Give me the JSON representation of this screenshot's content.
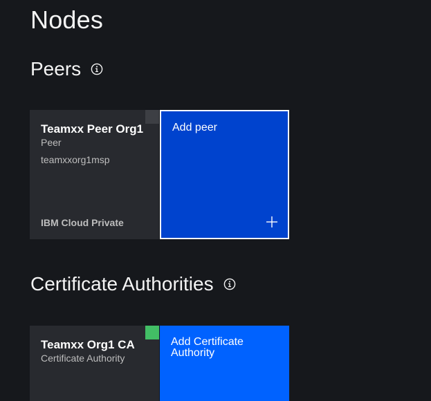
{
  "page": {
    "title": "Nodes"
  },
  "peers_section": {
    "heading": "Peers",
    "info_icon": "info-icon",
    "node": {
      "name": "Teamxx Peer Org1",
      "type": "Peer",
      "msp": "teamxxorg1msp",
      "location": "IBM Cloud Private",
      "status_color": "#3d3f44"
    },
    "add_tile": {
      "label": "Add peer",
      "icon": "plus-icon",
      "color": "#0043ce"
    }
  },
  "ca_section": {
    "heading": "Certificate Authorities",
    "info_icon": "info-icon",
    "node": {
      "name": "Teamxx Org1 CA",
      "type": "Certificate Authority",
      "status_color": "#42be65"
    },
    "add_tile": {
      "label": "Add Certificate Authority",
      "color": "#0062ff"
    }
  }
}
